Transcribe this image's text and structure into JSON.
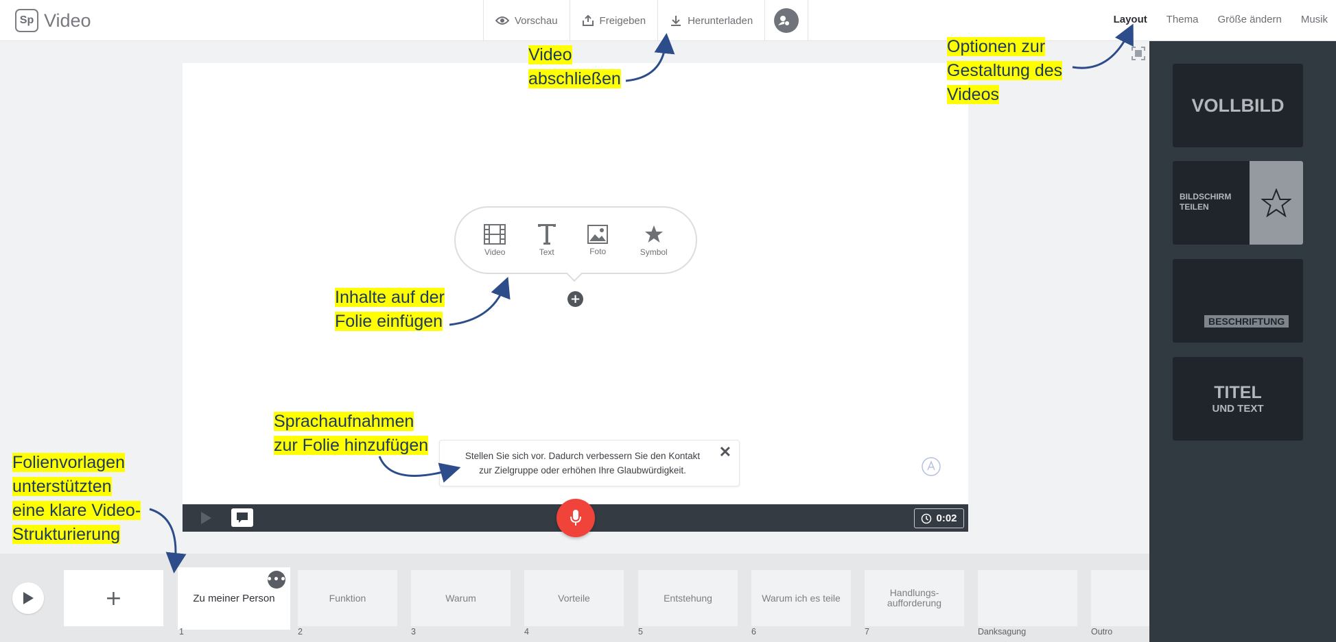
{
  "app": {
    "logo_mark": "Sp",
    "title": "Video"
  },
  "toolbar": {
    "preview": "Vorschau",
    "share": "Freigeben",
    "download": "Herunterladen",
    "avatar_icon": "user-add-icon"
  },
  "tabs": {
    "layout": "Layout",
    "theme": "Thema",
    "resize": "Größe ändern",
    "music": "Musik"
  },
  "content_bubble": {
    "video": "Video",
    "text": "Text",
    "photo": "Foto",
    "symbol": "Symbol"
  },
  "tip": {
    "text": "Stellen Sie sich vor. Dadurch verbessern Sie den Kontakt zur Zielgruppe oder erhöhen Ihre Glaubwürdigkeit."
  },
  "player": {
    "time": "0:02"
  },
  "layouts": {
    "fullscreen": "VOLLBILD",
    "split_line1": "BILDSCHIRM",
    "split_line2": "TEILEN",
    "caption": "BESCHRIFTUNG",
    "title_line1": "TITEL",
    "title_line2": "UND TEXT"
  },
  "slides": [
    {
      "num": "1",
      "label": "Zu meiner Person"
    },
    {
      "num": "2",
      "label": "Funktion"
    },
    {
      "num": "3",
      "label": "Warum"
    },
    {
      "num": "4",
      "label": "Vorteile"
    },
    {
      "num": "5",
      "label": "Entstehung"
    },
    {
      "num": "6",
      "label": "Warum ich es teile"
    },
    {
      "num": "7",
      "label": "Handlungs-\naufforderung"
    },
    {
      "num": "Danksagung",
      "label": ""
    },
    {
      "num": "Outro",
      "label": ""
    }
  ],
  "annotations": {
    "finish_1": "Video",
    "finish_2": "abschließen",
    "design_1": "Optionen zur",
    "design_2": "Gestaltung des",
    "design_3": "Videos",
    "insert_1": "Inhalte auf der",
    "insert_2": "Folie einfügen",
    "voice_1": "Sprachaufnahmen",
    "voice_2": "zur Folie hinzufügen",
    "tpl_1": "Folienvorlagen",
    "tpl_2": "unterstützten",
    "tpl_3": "eine klare Video-",
    "tpl_4": "Strukturierung"
  },
  "colors": {
    "accent_mic": "#f0443a",
    "highlight": "#ffff00",
    "arrow": "#2c4d8a",
    "panel": "#323a41"
  }
}
